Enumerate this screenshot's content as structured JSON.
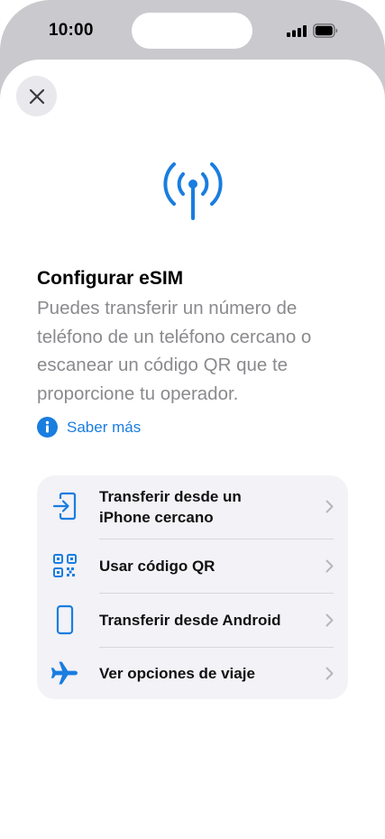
{
  "status_bar": {
    "time": "10:00"
  },
  "header": {
    "close_icon": "close-icon"
  },
  "hero": {
    "icon": "antenna-signal-icon",
    "accent": "#1a7de0"
  },
  "content": {
    "title": "Configurar eSIM",
    "subtitle": "Puedes transferir un número de teléfono de un teléfono cercano o escanear un código QR que te proporcione tu operador.",
    "learn_more": "Saber más"
  },
  "options": [
    {
      "label": "Transferir desde un iPhone cercano",
      "icon": "transfer-in-icon"
    },
    {
      "label": "Usar código QR",
      "icon": "qr-code-icon"
    },
    {
      "label": "Transferir desde Android",
      "icon": "phone-icon"
    },
    {
      "label": "Ver opciones de viaje",
      "icon": "airplane-icon"
    }
  ]
}
